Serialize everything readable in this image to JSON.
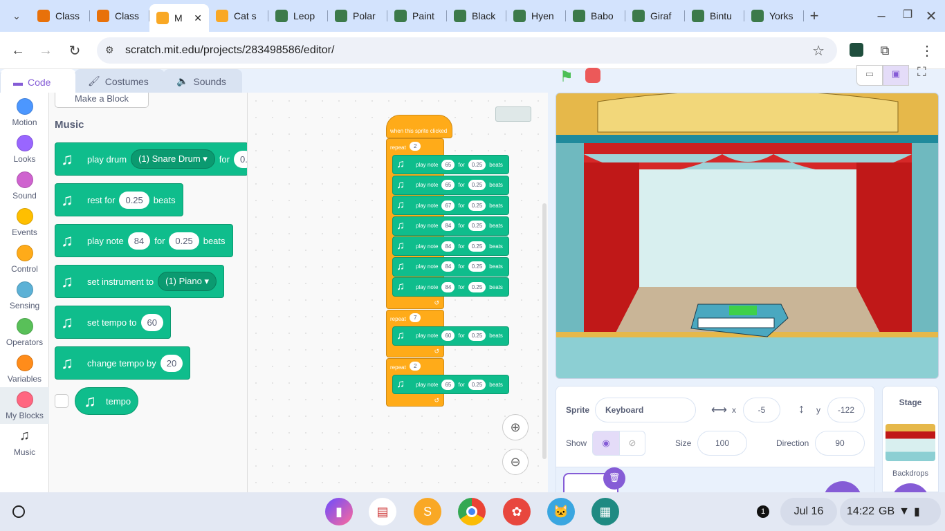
{
  "browser": {
    "tabs": [
      {
        "title": "Class",
        "icon": "google-classroom-icon",
        "color": "#e8710a"
      },
      {
        "title": "Class",
        "icon": "google-classroom-icon",
        "color": "#e8710a"
      },
      {
        "title": "M",
        "icon": "scratch-icon",
        "color": "#f9a825",
        "active": true
      },
      {
        "title": "Cat s",
        "icon": "scratch-icon",
        "color": "#f9a825"
      },
      {
        "title": "Leop",
        "icon": "tab-favicon-icon",
        "color": "#3c7a4a"
      },
      {
        "title": "Polar",
        "icon": "tab-favicon-icon",
        "color": "#3c7a4a"
      },
      {
        "title": "Paint",
        "icon": "tab-favicon-icon",
        "color": "#3c7a4a"
      },
      {
        "title": "Black",
        "icon": "tab-favicon-icon",
        "color": "#3c7a4a"
      },
      {
        "title": "Hyen",
        "icon": "tab-favicon-icon",
        "color": "#3c7a4a"
      },
      {
        "title": "Babo",
        "icon": "tab-favicon-icon",
        "color": "#3c7a4a"
      },
      {
        "title": "Giraf",
        "icon": "tab-favicon-icon",
        "color": "#3c7a4a"
      },
      {
        "title": "Bintu",
        "icon": "tab-favicon-icon",
        "color": "#3c7a4a"
      },
      {
        "title": "Yorks",
        "icon": "tab-favicon-icon",
        "color": "#3c7a4a"
      }
    ],
    "url": "scratch.mit.edu/projects/283498586/editor/"
  },
  "editor_tabs": {
    "code": "Code",
    "costumes": "Costumes",
    "sounds": "Sounds"
  },
  "categories": [
    {
      "label": "Motion",
      "color": "#4c97ff"
    },
    {
      "label": "Looks",
      "color": "#9966ff"
    },
    {
      "label": "Sound",
      "color": "#cf63cf"
    },
    {
      "label": "Events",
      "color": "#ffbf00"
    },
    {
      "label": "Control",
      "color": "#ffab19"
    },
    {
      "label": "Sensing",
      "color": "#5cb1d6"
    },
    {
      "label": "Operators",
      "color": "#59c059"
    },
    {
      "label": "Variables",
      "color": "#ff8c1a"
    },
    {
      "label": "My Blocks",
      "color": "#ff6680"
    },
    {
      "label": "Music",
      "color": "#0fbd8c"
    }
  ],
  "palette": {
    "make_block": "Make a Block",
    "section": "Music",
    "blocks": {
      "play_drum": {
        "label": "play drum",
        "drum": "(1) Snare Drum",
        "for": "for",
        "value": "0."
      },
      "rest": {
        "label": "rest for",
        "value": "0.25",
        "unit": "beats"
      },
      "play_note": {
        "label": "play note",
        "note": "84",
        "for": "for",
        "value": "0.25",
        "unit": "beats"
      },
      "set_instrument": {
        "label": "set instrument to",
        "instrument": "(1) Piano"
      },
      "set_tempo": {
        "label": "set tempo to",
        "value": "60"
      },
      "change_tempo": {
        "label": "change tempo by",
        "value": "20"
      },
      "tempo": {
        "label": "tempo"
      }
    }
  },
  "script": {
    "hat": "when this sprite clicked",
    "repeat_label": "repeat",
    "note_label": "play note",
    "for_label": "for",
    "beats_label": "beats",
    "repeats": [
      {
        "count": "2",
        "notes": [
          {
            "note": "65",
            "beats": "0.25"
          },
          {
            "note": "65",
            "beats": "0.25"
          },
          {
            "note": "67",
            "beats": "0.25"
          },
          {
            "note": "84",
            "beats": "0.25"
          },
          {
            "note": "84",
            "beats": "0.25"
          },
          {
            "note": "84",
            "beats": "0.25"
          },
          {
            "note": "84",
            "beats": "0.25"
          }
        ]
      },
      {
        "count": "7",
        "notes": [
          {
            "note": "60",
            "beats": "0.25"
          }
        ]
      },
      {
        "count": "2",
        "notes": [
          {
            "note": "65",
            "beats": "0.25"
          }
        ]
      }
    ]
  },
  "sprite_info": {
    "sprite_label": "Sprite",
    "sprite_name": "Keyboard",
    "x_label": "x",
    "x": "-5",
    "y_label": "y",
    "y": "-122",
    "show_label": "Show",
    "size_label": "Size",
    "size": "100",
    "direction_label": "Direction",
    "direction": "90"
  },
  "stage_pane": {
    "title": "Stage",
    "backdrops": "Backdrops"
  },
  "taskbar": {
    "notifications": "1",
    "date": "Jul 16",
    "time": "14:22",
    "locale": "GB"
  }
}
